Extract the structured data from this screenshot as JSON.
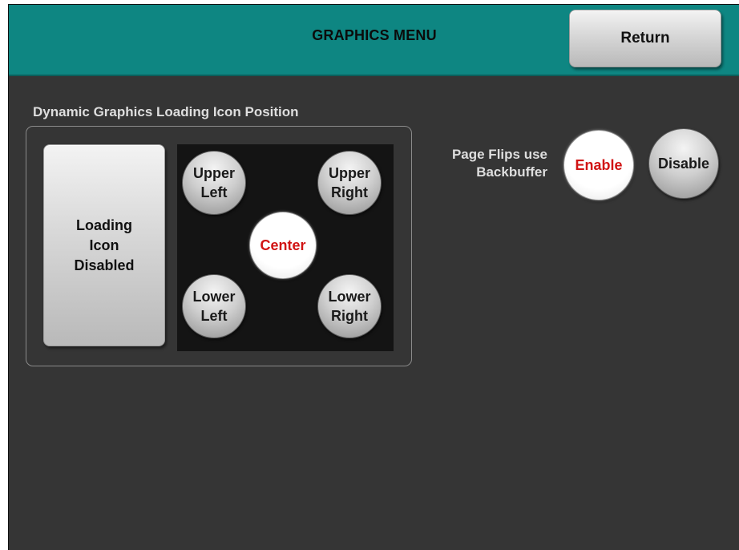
{
  "header": {
    "title": "GRAPHICS MENU",
    "return_label": "Return"
  },
  "loading_icon_section": {
    "label": "Dynamic Graphics Loading Icon Position",
    "disabled_button_label": "Loading\nIcon\nDisabled",
    "positions": {
      "upper_left": "Upper\nLeft",
      "upper_right": "Upper\nRight",
      "center": "Center",
      "lower_left": "Lower\nLeft",
      "lower_right": "Lower\nRight"
    },
    "selected_position": "Center"
  },
  "page_flips": {
    "label": "Page Flips use\nBackbuffer",
    "enable_label": "Enable",
    "disable_label": "Disable",
    "selected": "Enable"
  },
  "colors": {
    "header_bg": "#0e8682",
    "screen_bg": "#353535",
    "selected_text": "#d11414",
    "panel_bg": "#141414"
  }
}
